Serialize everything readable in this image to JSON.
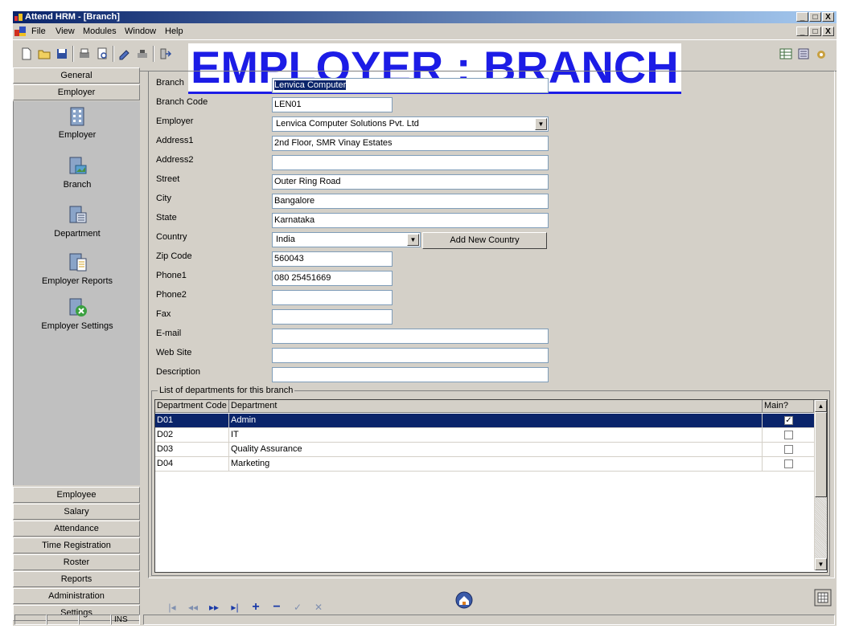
{
  "window": {
    "title": "Attend HRM - [Branch]",
    "controls": [
      "_",
      "□",
      "X"
    ]
  },
  "menu": {
    "items": [
      "File",
      "View",
      "Modules",
      "Window",
      "Help"
    ]
  },
  "banner": "EMPLOYER : BRANCH",
  "nav": {
    "top_buttons": [
      "General",
      "Employer"
    ],
    "panel_items": [
      "Employer",
      "Branch",
      "Department",
      "Employer Reports",
      "Employer Settings"
    ],
    "bottom_buttons": [
      "Employee",
      "Salary",
      "Attendance",
      "Time Registration",
      "Roster",
      "Reports",
      "Administration",
      "Settings"
    ]
  },
  "form": {
    "labels": {
      "branch": "Branch",
      "branch_code": "Branch Code",
      "employer": "Employer",
      "address1": "Address1",
      "address2": "Address2",
      "street": "Street",
      "city": "City",
      "state": "State",
      "country": "Country",
      "zip": "Zip Code",
      "phone1": "Phone1",
      "phone2": "Phone2",
      "fax": "Fax",
      "email": "E-mail",
      "website": "Web Site",
      "description": "Description"
    },
    "values": {
      "branch": "Lenvica Computer",
      "branch_code": "LEN01",
      "employer": "Lenvica Computer Solutions Pvt. Ltd",
      "address1": "2nd Floor, SMR Vinay Estates",
      "address2": "",
      "street": "Outer Ring Road",
      "city": "Bangalore",
      "state": "Karnataka",
      "country": "India",
      "zip": "560043",
      "phone1": "080 25451669",
      "phone2": "",
      "fax": "",
      "email": "",
      "website": "",
      "description": ""
    },
    "add_country_label": "Add New Country"
  },
  "departments": {
    "group_label": "List of departments for this branch",
    "columns": [
      "Department Code",
      "Department",
      "Main?"
    ],
    "rows": [
      {
        "code": "D01",
        "name": "Admin",
        "main": "✓"
      },
      {
        "code": "D02",
        "name": "IT",
        "main": ""
      },
      {
        "code": "D03",
        "name": "Quality Assurance",
        "main": ""
      },
      {
        "code": "D04",
        "name": "Marketing",
        "main": ""
      }
    ]
  },
  "status": {
    "mode": "INS"
  },
  "colors": {
    "banner": "#1c1ce6",
    "selection": "#0a246a",
    "face": "#d4d0c8"
  }
}
